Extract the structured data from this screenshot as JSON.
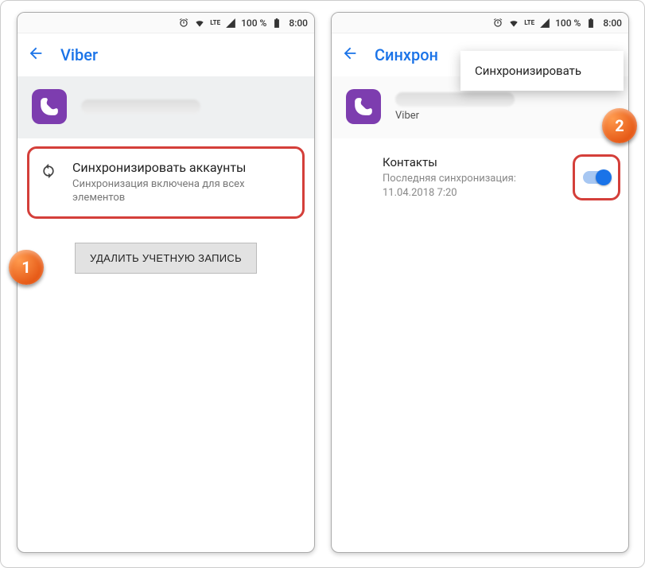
{
  "status": {
    "battery_pct": "100 %",
    "time": "8:00"
  },
  "left": {
    "title": "Viber",
    "sync": {
      "title": "Синхронизировать аккаунты",
      "subtitle": "Синхронизация включена для всех элементов"
    },
    "delete_btn": "УДАЛИТЬ УЧЕТНУЮ ЗАПИСЬ"
  },
  "right": {
    "title": "Синхрон",
    "menu_item": "Синхронизировать",
    "account_sub": "Viber",
    "contacts": {
      "title": "Контакты",
      "subtitle": "Последняя синхронизация: 11.04.2018 7:20"
    }
  },
  "badges": {
    "one": "1",
    "two": "2"
  }
}
